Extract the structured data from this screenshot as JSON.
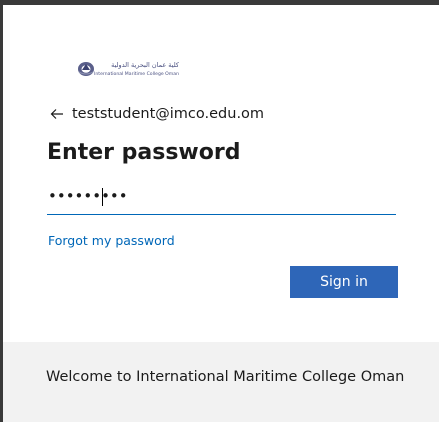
{
  "branding": {
    "logo_icon": "institution-logo-icon",
    "logo_arabic_text": "كلية عمان البحرية الدولية",
    "logo_english_text": "International Maritime College Oman"
  },
  "identity": {
    "back_icon": "back-arrow-icon",
    "email": "teststudent@imco.edu.om"
  },
  "form": {
    "title": "Enter password",
    "password_value": "•••••••••",
    "forgot_link": "Forgot my password",
    "submit_label": "Sign in"
  },
  "footer": {
    "text": "Welcome to International Maritime College Oman"
  },
  "colors": {
    "accent": "#0067b8",
    "button": "#2e66b8",
    "footer_bg": "#f2f2f2"
  }
}
